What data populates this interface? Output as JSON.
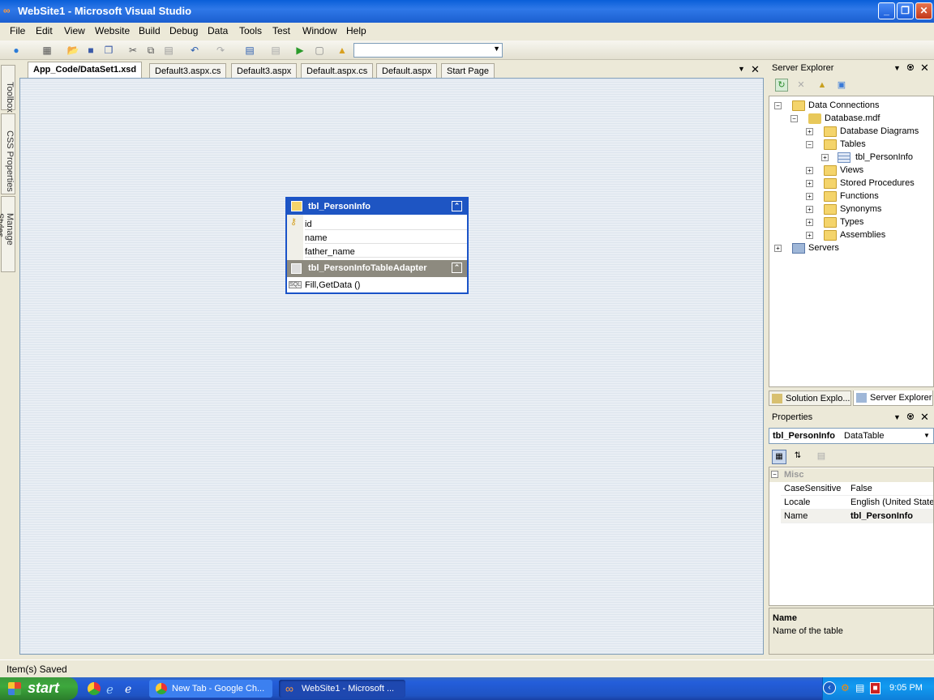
{
  "window": {
    "title": "WebSite1 - Microsoft Visual Studio"
  },
  "menu": [
    "File",
    "Edit",
    "View",
    "Website",
    "Build",
    "Debug",
    "Data",
    "Tools",
    "Test",
    "Window",
    "Help"
  ],
  "left_tabs": [
    "Toolbox",
    "CSS Properties",
    "Manage Styles"
  ],
  "doc_tabs": [
    "App_Code/DataSet1.xsd",
    "Default3.aspx.cs",
    "Default3.aspx",
    "Default.aspx.cs",
    "Default.aspx",
    "Start Page"
  ],
  "table": {
    "name": "tbl_PersonInfo",
    "columns": [
      "id",
      "name",
      "father_name"
    ],
    "adapter": "tbl_PersonInfoTableAdapter",
    "method": "Fill,GetData ()"
  },
  "server_explorer": {
    "title": "Server Explorer",
    "tree": [
      {
        "label": "Data Connections"
      },
      {
        "label": "Database.mdf"
      },
      {
        "label": "Database Diagrams"
      },
      {
        "label": "Tables"
      },
      {
        "label": "tbl_PersonInfo"
      },
      {
        "label": "Views"
      },
      {
        "label": "Stored Procedures"
      },
      {
        "label": "Functions"
      },
      {
        "label": "Synonyms"
      },
      {
        "label": "Types"
      },
      {
        "label": "Assemblies"
      },
      {
        "label": "Servers"
      }
    ],
    "switch_tabs": [
      "Solution Explo...",
      "Server Explorer"
    ]
  },
  "properties": {
    "title": "Properties",
    "selected_object": "tbl_PersonInfo",
    "selected_type": "DataTable",
    "category": "Misc",
    "rows": [
      {
        "key": "CaseSensitive",
        "value": "False"
      },
      {
        "key": "Locale",
        "value": "English (United States)"
      },
      {
        "key": "Name",
        "value": "tbl_PersonInfo"
      }
    ],
    "desc_title": "Name",
    "desc_text": "Name of the table"
  },
  "status": "Item(s) Saved",
  "taskbar": {
    "start": "start",
    "tasks": [
      "New Tab - Google Ch...",
      "WebSite1 - Microsoft ..."
    ],
    "clock": "9:05 PM"
  }
}
